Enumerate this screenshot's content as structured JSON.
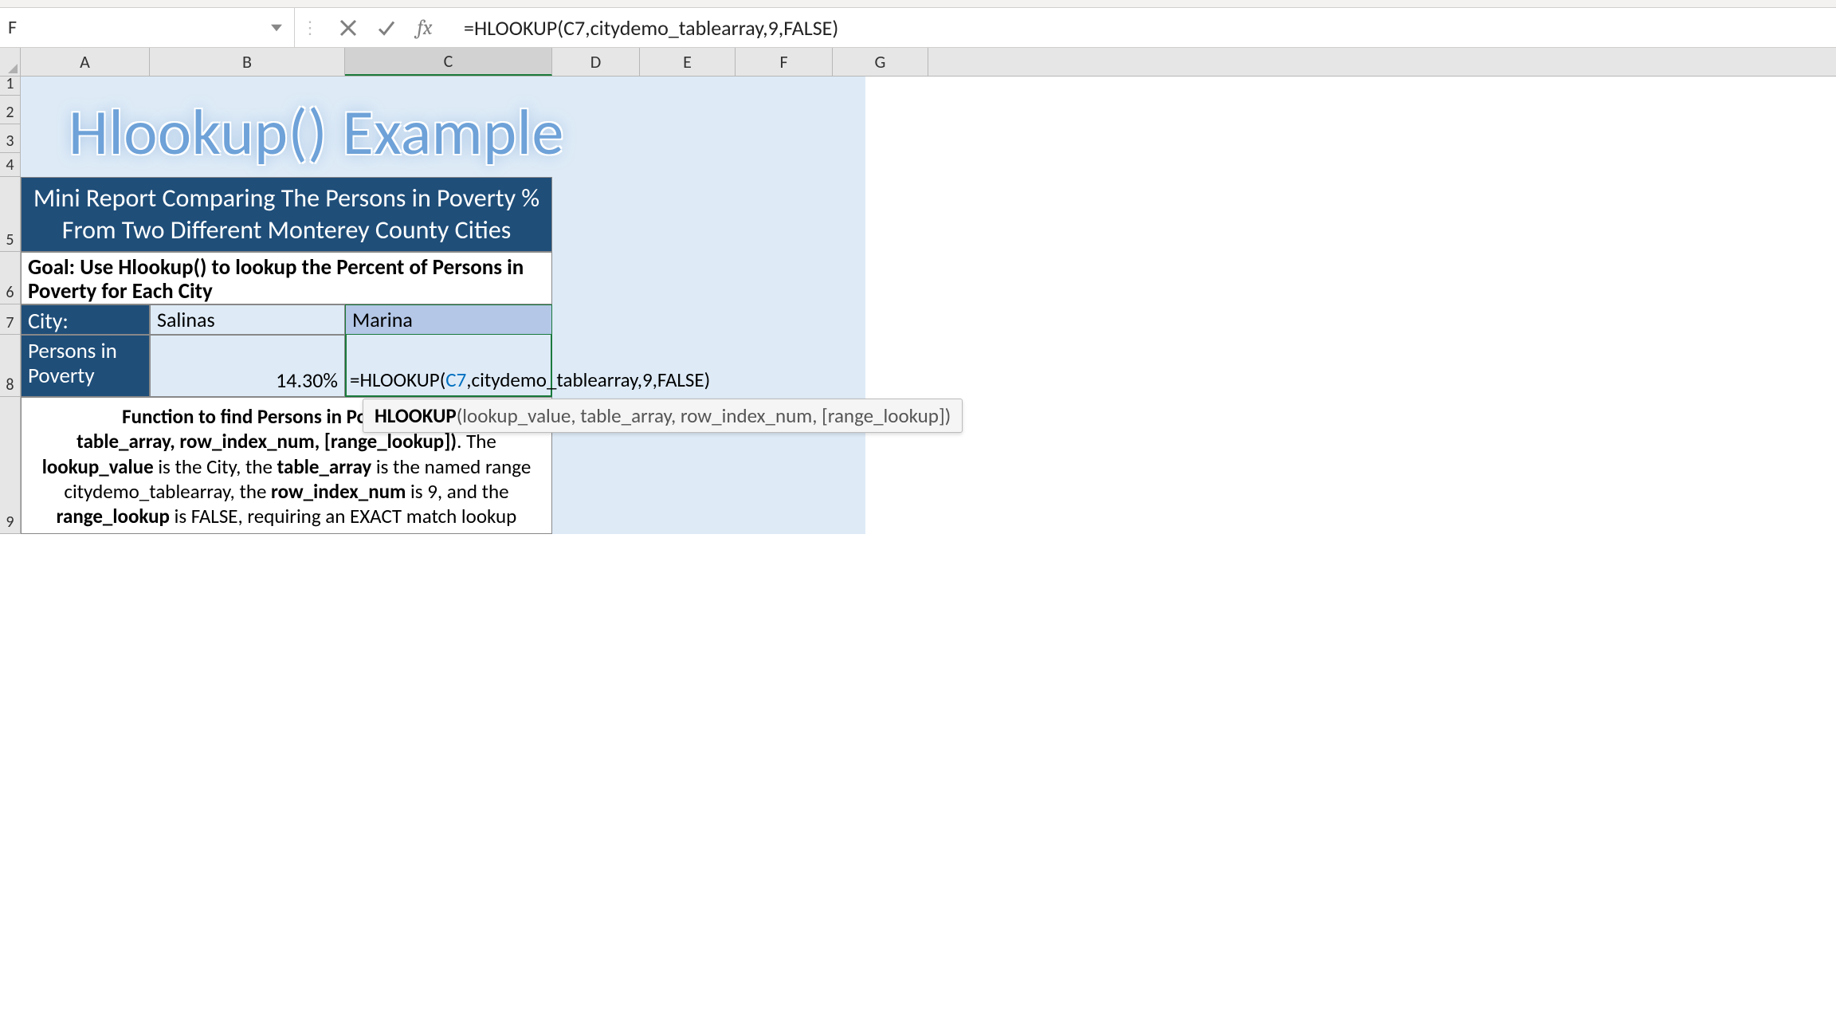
{
  "nameBox": {
    "value": "F"
  },
  "formulaBar": {
    "fxLabel": "fx",
    "formula": "=HLOOKUP(C7,citydemo_tablearray,9,FALSE)"
  },
  "columns": [
    "A",
    "B",
    "C",
    "D",
    "E",
    "F",
    "G"
  ],
  "rows": [
    "1",
    "2",
    "3",
    "4",
    "5",
    "6",
    "7",
    "8",
    "9"
  ],
  "sheet": {
    "title": "Hlookup() Example",
    "reportHeader": {
      "line1": "Mini Report Comparing The Persons in Poverty %",
      "line2": "From Two Different Monterey County Cities"
    },
    "goal": "Goal: Use Hlookup() to lookup the Percent of Persons in Poverty for Each City",
    "cityLabel": "City:",
    "cityB": "Salinas",
    "cityC": "Marina",
    "povLabel": "Persons in Poverty",
    "povB": "14.30%",
    "editingFormula": {
      "prefix": "=HLO",
      "afterCaret": "OKUP(",
      "ref": "C7",
      "suffix": ",citydemo_tablearray,9,FALSE)"
    },
    "explanation": {
      "p1a": "Function to find Persons in Poverty: =HL",
      "p1gap": "                                         ",
      "p2a": "table_array, row_index_num, [range_lookup])",
      "p2b": ". The ",
      "p2c": "lookup_value",
      "p2d": " is the City, the ",
      "p2e": "table_array",
      "p2f": " is the named range citydemo_tablearray, the ",
      "p2g": "row_index_num",
      "p2h": " is 9, and the ",
      "p2i": "range_lookup",
      "p2j": " is FALSE, requiring an EXACT match lookup"
    }
  },
  "tooltip": {
    "fn": "HLOOKUP",
    "sig": "(lookup_value, table_array, row_index_num, [range_lookup])"
  }
}
